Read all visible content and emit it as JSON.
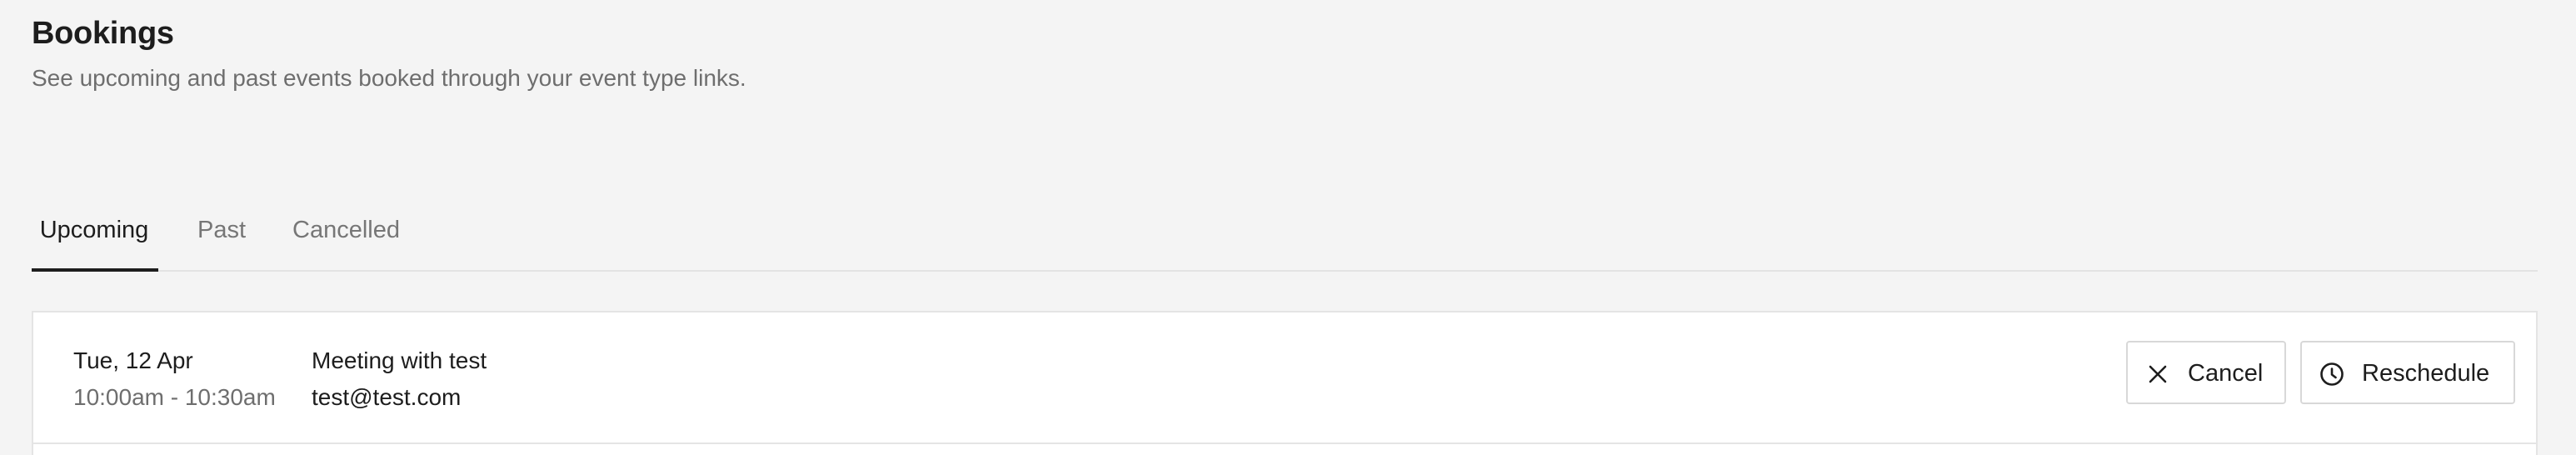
{
  "header": {
    "title": "Bookings",
    "subtitle": "See upcoming and past events booked through your event type links."
  },
  "tabs": [
    {
      "label": "Upcoming",
      "active": true
    },
    {
      "label": "Past",
      "active": false
    },
    {
      "label": "Cancelled",
      "active": false
    }
  ],
  "bookings": [
    {
      "date": "Tue, 12 Apr",
      "time": "10:00am - 10:30am",
      "title": "Meeting with test",
      "email": "test@test.com",
      "actions": {
        "cancel": {
          "label": "Cancel",
          "icon": "close-icon"
        },
        "reschedule": {
          "label": "Reschedule",
          "icon": "clock-icon"
        }
      }
    }
  ],
  "colors": {
    "background": "#f4f4f4",
    "card": "#ffffff",
    "border": "#e4e4e4",
    "text": "#1d1d1d",
    "muted": "#6e6e6e",
    "active_tab_indicator": "#1d1d1d"
  }
}
